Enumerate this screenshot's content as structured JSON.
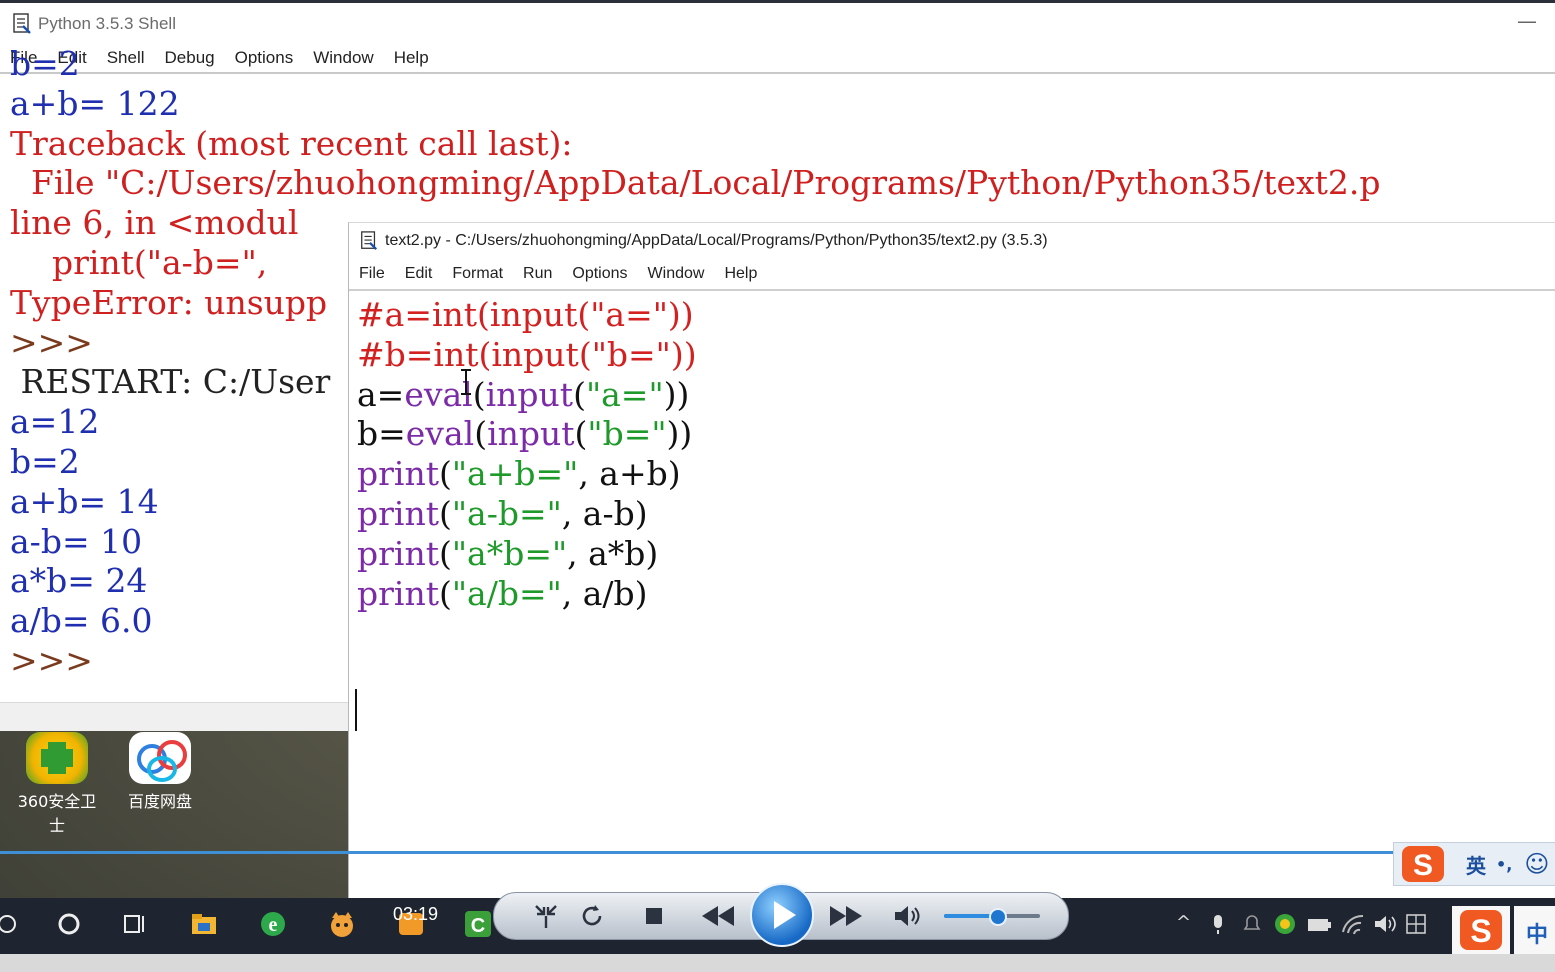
{
  "shell": {
    "title": "Python 3.5.3 Shell",
    "minimize": "—",
    "menu": [
      "File",
      "Edit",
      "Shell",
      "Debug",
      "Options",
      "Window",
      "Help"
    ],
    "lines": [
      {
        "text": "b=2",
        "color": "blue"
      },
      {
        "text": "a+b= 122",
        "color": "blue"
      },
      {
        "text": "Traceback (most recent call last):",
        "color": "red"
      },
      {
        "text": "  File \"C:/Users/zhuohongming/AppData/Local/Programs/Python/Python35/text2.p",
        "color": "red"
      },
      {
        "text": "line 6, in <modul",
        "color": "red"
      },
      {
        "text": "    print(\"a-b=\",",
        "color": "red"
      },
      {
        "text": "TypeError: unsupp",
        "color": "red"
      },
      {
        "text": ">>>",
        "color": "prompt"
      },
      {
        "text": " RESTART: C:/User",
        "color": "dark"
      },
      {
        "text": "a=12",
        "color": "blue"
      },
      {
        "text": "b=2",
        "color": "blue"
      },
      {
        "text": "a+b= 14",
        "color": "blue"
      },
      {
        "text": "a-b= 10",
        "color": "blue"
      },
      {
        "text": "a*b= 24",
        "color": "blue"
      },
      {
        "text": "a/b= 6.0",
        "color": "blue"
      },
      {
        "text": ">>>",
        "color": "prompt"
      }
    ]
  },
  "desktop_icons": [
    {
      "label": "360安全卫士",
      "icon": "360-safe-icon"
    },
    {
      "label": "百度网盘",
      "icon": "baidu-netdisk-icon"
    }
  ],
  "editor": {
    "title": "text2.py - C:/Users/zhuohongming/AppData/Local/Programs/Python/Python35/text2.py (3.5.3)",
    "menu": [
      "File",
      "Edit",
      "Format",
      "Run",
      "Options",
      "Window",
      "Help"
    ],
    "code": [
      [
        {
          "t": "#a=int(input(\"a=\"))",
          "c": "cmt"
        }
      ],
      [
        {
          "t": "#b=int(input(\"b=\"))",
          "c": "cmt"
        }
      ],
      [
        {
          "t": "a=",
          "c": "txt"
        },
        {
          "t": "eval",
          "c": "kw"
        },
        {
          "t": "(",
          "c": "txt"
        },
        {
          "t": "input",
          "c": "kw"
        },
        {
          "t": "(",
          "c": "txt"
        },
        {
          "t": "\"a=\"",
          "c": "str"
        },
        {
          "t": "))",
          "c": "txt"
        }
      ],
      [
        {
          "t": "b=",
          "c": "txt"
        },
        {
          "t": "eval",
          "c": "kw"
        },
        {
          "t": "(",
          "c": "txt"
        },
        {
          "t": "input",
          "c": "kw"
        },
        {
          "t": "(",
          "c": "txt"
        },
        {
          "t": "\"b=\"",
          "c": "str"
        },
        {
          "t": "))",
          "c": "txt"
        }
      ],
      [
        {
          "t": "print",
          "c": "kw"
        },
        {
          "t": "(",
          "c": "txt"
        },
        {
          "t": "\"a+b=\"",
          "c": "str"
        },
        {
          "t": ", a+b)",
          "c": "txt"
        }
      ],
      [
        {
          "t": "print",
          "c": "kw"
        },
        {
          "t": "(",
          "c": "txt"
        },
        {
          "t": "\"a-b=\"",
          "c": "str"
        },
        {
          "t": ", a-b)",
          "c": "txt"
        }
      ],
      [
        {
          "t": "print",
          "c": "kw"
        },
        {
          "t": "(",
          "c": "txt"
        },
        {
          "t": "\"a*b=\"",
          "c": "str"
        },
        {
          "t": ", a*b)",
          "c": "txt"
        }
      ],
      [
        {
          "t": "print",
          "c": "kw"
        },
        {
          "t": "(",
          "c": "txt"
        },
        {
          "t": "\"a/b=\"",
          "c": "str"
        },
        {
          "t": ", a/b)",
          "c": "txt"
        }
      ]
    ]
  },
  "ime": {
    "mode": "英",
    "punct": "•,",
    "emoji": "☺",
    "taskbar_label": "中"
  },
  "player": {
    "time": "03:19",
    "buttons": [
      "shrink-icon",
      "repeat-icon",
      "stop-icon",
      "rewind-icon",
      "play-icon",
      "fast-forward-icon",
      "volume-icon"
    ],
    "volume": 0.55
  },
  "colors": {
    "shell_blue": "#1f2fb0",
    "error_red": "#cf1f1f",
    "keyword_purple": "#7b2aa8",
    "string_green": "#1e9a2a",
    "progress_blue": "#3f8fd6"
  }
}
